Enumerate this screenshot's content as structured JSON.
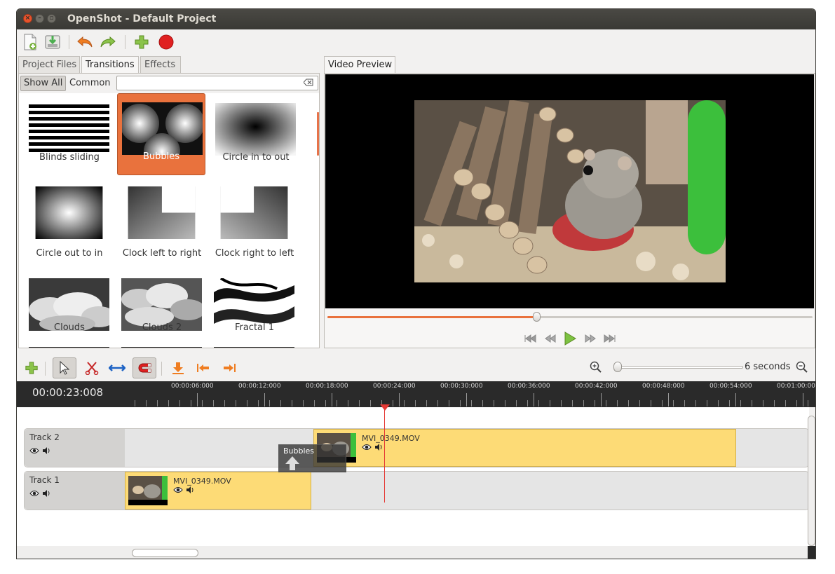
{
  "window": {
    "title": "OpenShot - Default Project"
  },
  "toolbar": {
    "icons": [
      "new-project-icon",
      "save-project-icon",
      "undo-icon",
      "redo-icon",
      "import-files-icon",
      "record-icon"
    ]
  },
  "left_tabs": {
    "project_files": "Project Files",
    "transitions": "Transitions",
    "effects": "Effects"
  },
  "filter": {
    "show_all": "Show All",
    "common": "Common",
    "search_value": ""
  },
  "transitions": [
    {
      "label": "Blinds sliding",
      "icon": "blinds-thumb"
    },
    {
      "label": "Bubbles",
      "icon": "bubbles-thumb",
      "selected": true
    },
    {
      "label": "Circle in to out",
      "icon": "circle-in-out-thumb"
    },
    {
      "label": "Circle out to in",
      "icon": "circle-out-in-thumb"
    },
    {
      "label": "Clock left to right",
      "icon": "clock-left-right-thumb"
    },
    {
      "label": "Clock right to left",
      "icon": "clock-right-left-thumb"
    },
    {
      "label": "Clouds",
      "icon": "clouds-thumb"
    },
    {
      "label": "Clouds 2",
      "icon": "clouds-2-thumb"
    },
    {
      "label": "Fractal 1",
      "icon": "fractal-1-thumb"
    }
  ],
  "right_tabs": {
    "video_preview": "Video Preview"
  },
  "preview": {
    "seek_progress": 0.43
  },
  "timeline_toolbar": {
    "zoom_label": "6 seconds",
    "zoom_level": 0.0
  },
  "timeline": {
    "current_time": "00:00:23:008",
    "ruler_labels": [
      "00:00:06:000",
      "00:00:12:000",
      "00:00:18:000",
      "00:00:24:000",
      "00:00:30:000",
      "00:00:36:000",
      "00:00:42:000",
      "00:00:48:000",
      "00:00:54:000",
      "00:01:00:000"
    ],
    "tracks": [
      {
        "name": "Track 2",
        "clip": "MVI_0349.MOV"
      },
      {
        "name": "Track 1",
        "clip": "MVI_0349.MOV"
      }
    ],
    "drag_transition": "Bubbles"
  },
  "colors": {
    "accent": "#e9723d",
    "clip": "#fddb76",
    "playhead": "#e53935"
  }
}
